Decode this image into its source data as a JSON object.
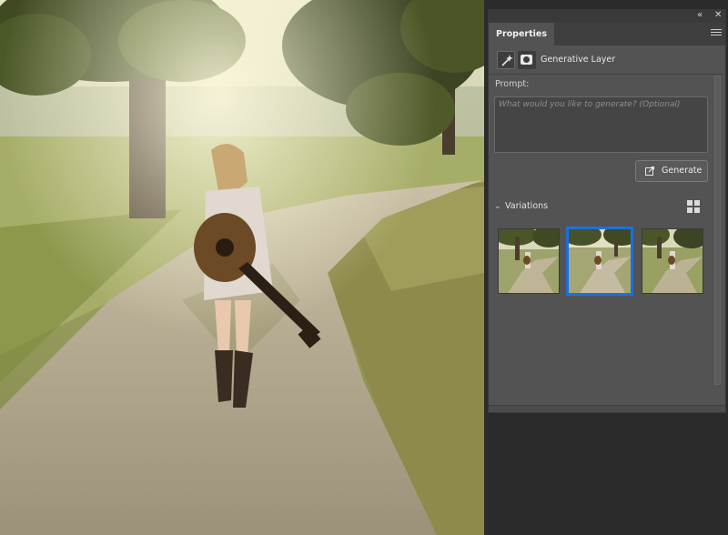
{
  "dock": {
    "collapse_icon": "double-chevron-left-icon",
    "close_icon": "close-icon"
  },
  "panel": {
    "tab_label": "Properties",
    "menu_icon": "hamburger-menu-icon"
  },
  "layer": {
    "type_icon": "generative-sparkle-icon",
    "mask_icon": "layer-mask-icon",
    "name": "Generative Layer"
  },
  "prompt": {
    "label": "Prompt:",
    "value": "",
    "placeholder": "What would you like to generate? (Optional)"
  },
  "generate": {
    "label": "Generate",
    "icon": "generate-icon"
  },
  "variations": {
    "label": "Variations",
    "expanded": true,
    "view_icon": "grid-view-icon",
    "selected_index": 1,
    "items": [
      {
        "name": "variation-1"
      },
      {
        "name": "variation-2"
      },
      {
        "name": "variation-3"
      }
    ]
  },
  "colors": {
    "panel_bg": "#535353",
    "tab_bar": "#3f3f3f",
    "selection_accent": "#1d6fe0",
    "app_bg": "#2b2b2b"
  }
}
